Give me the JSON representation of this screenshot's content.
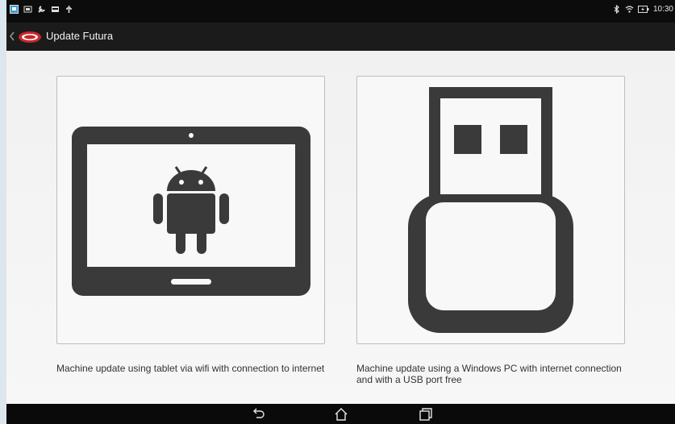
{
  "status_bar": {
    "time": "10:30",
    "left_icons": [
      "screenshot-icon",
      "gallery-icon",
      "wrench-icon",
      "message-icon",
      "usb-debug-icon"
    ],
    "right_icons": [
      "bluetooth-icon",
      "wifi-icon",
      "battery-charging-icon"
    ]
  },
  "action_bar": {
    "title": "Update Futura",
    "logo": "silca-logo"
  },
  "options": [
    {
      "icon": "android-tablet-icon",
      "caption": "Machine update using tablet via wifi with connection to internet"
    },
    {
      "icon": "usb-drive-icon",
      "caption": "Machine update using a Windows PC with internet connection and with a USB port free"
    }
  ],
  "nav_bar": {
    "buttons": [
      "back-icon",
      "home-icon",
      "recent-apps-icon"
    ]
  },
  "colors": {
    "status_bar": "#0c0c0c",
    "action_bar": "#1b1b1b",
    "icon_fill": "#3a3a3a",
    "logo_red": "#c8262b"
  }
}
